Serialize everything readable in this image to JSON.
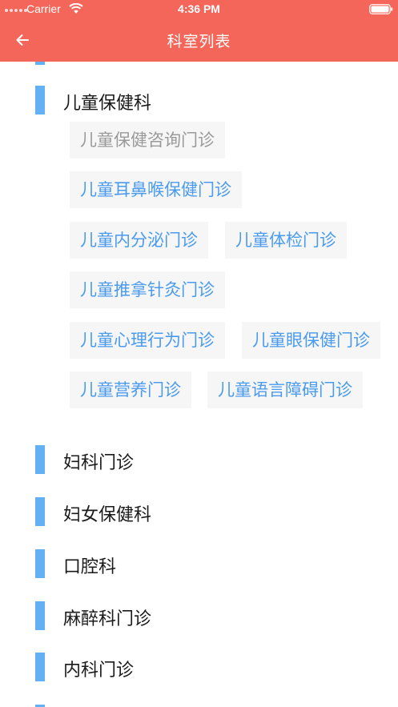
{
  "status_bar": {
    "carrier": "Carrier",
    "time": "4:36 PM"
  },
  "nav": {
    "title": "科室列表",
    "back_icon": "arrow-left-icon"
  },
  "colors": {
    "header_bg": "#f5665a",
    "accent_bar": "#63b0f4",
    "chip_text": "#4a9bee",
    "chip_text_muted": "#9a9a9a",
    "chip_bg": "#f6f6f6"
  },
  "departments": [
    {
      "name": "儿童保健科",
      "clinics": [
        "儿童保健咨询门诊",
        "儿童耳鼻喉保健门诊",
        "儿童内分泌门诊",
        "儿童体检门诊",
        "儿童推拿针灸门诊",
        "儿童心理行为门诊",
        "儿童眼保健门诊",
        "儿童营养门诊",
        "儿童语言障碍门诊"
      ]
    },
    {
      "name": "妇科门诊"
    },
    {
      "name": "妇女保健科"
    },
    {
      "name": "口腔科"
    },
    {
      "name": "麻醉科门诊"
    },
    {
      "name": "内科门诊"
    }
  ]
}
